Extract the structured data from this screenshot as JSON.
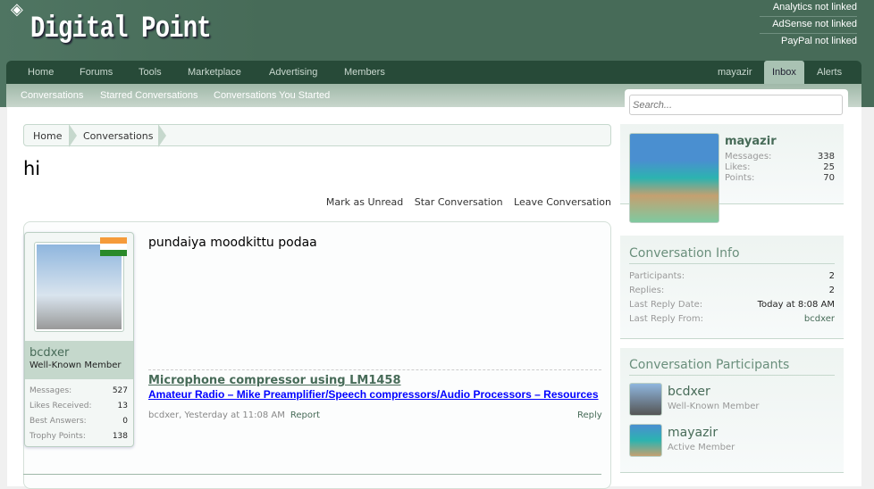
{
  "header": {
    "logo": "Digital Point",
    "links": [
      "Analytics not linked",
      "AdSense not linked",
      "PayPal not linked"
    ]
  },
  "nav": {
    "items": [
      "Home",
      "Forums",
      "Tools",
      "Marketplace",
      "Advertising",
      "Members"
    ],
    "user": "mayazir",
    "inbox": "Inbox",
    "alerts": "Alerts"
  },
  "subnav": [
    "Conversations",
    "Starred Conversations",
    "Conversations You Started"
  ],
  "search": {
    "placeholder": "Search..."
  },
  "breadcrumb": [
    "Home",
    "Conversations"
  ],
  "title": "hi",
  "actions": [
    "Mark as Unread",
    "Star Conversation",
    "Leave Conversation"
  ],
  "message": {
    "author": "bcdxer",
    "title": "Well-Known Member",
    "stats": [
      {
        "label": "Messages:",
        "value": "527"
      },
      {
        "label": "Likes Received:",
        "value": "13"
      },
      {
        "label": "Best Answers:",
        "value": "0"
      },
      {
        "label": "Trophy Points:",
        "value": "138"
      }
    ],
    "body": "pundaiya moodkittu podaa",
    "sig_title": "Microphone compressor using LM1458",
    "sig_link": "Amateur Radio – Mike Preamplifier/Speech compressors/Audio Processors – Resources",
    "meta": "bcdxer, Yesterday at 11:08 AM",
    "report": "Report",
    "reply": "Reply"
  },
  "visitor": {
    "name": "mayazir",
    "stats": [
      {
        "label": "Messages:",
        "value": "338"
      },
      {
        "label": "Likes:",
        "value": "25"
      },
      {
        "label": "Points:",
        "value": "70"
      }
    ]
  },
  "info": {
    "heading": "Conversation Info",
    "rows": [
      {
        "label": "Participants:",
        "value": "2"
      },
      {
        "label": "Replies:",
        "value": "2"
      },
      {
        "label": "Last Reply Date:",
        "value": "Today at 8:08 AM"
      },
      {
        "label": "Last Reply From:",
        "value": "bcdxer"
      }
    ]
  },
  "participants": {
    "heading": "Conversation Participants",
    "list": [
      {
        "name": "bcdxer",
        "title": "Well-Known Member"
      },
      {
        "name": "mayazir",
        "title": "Active Member"
      }
    ]
  }
}
